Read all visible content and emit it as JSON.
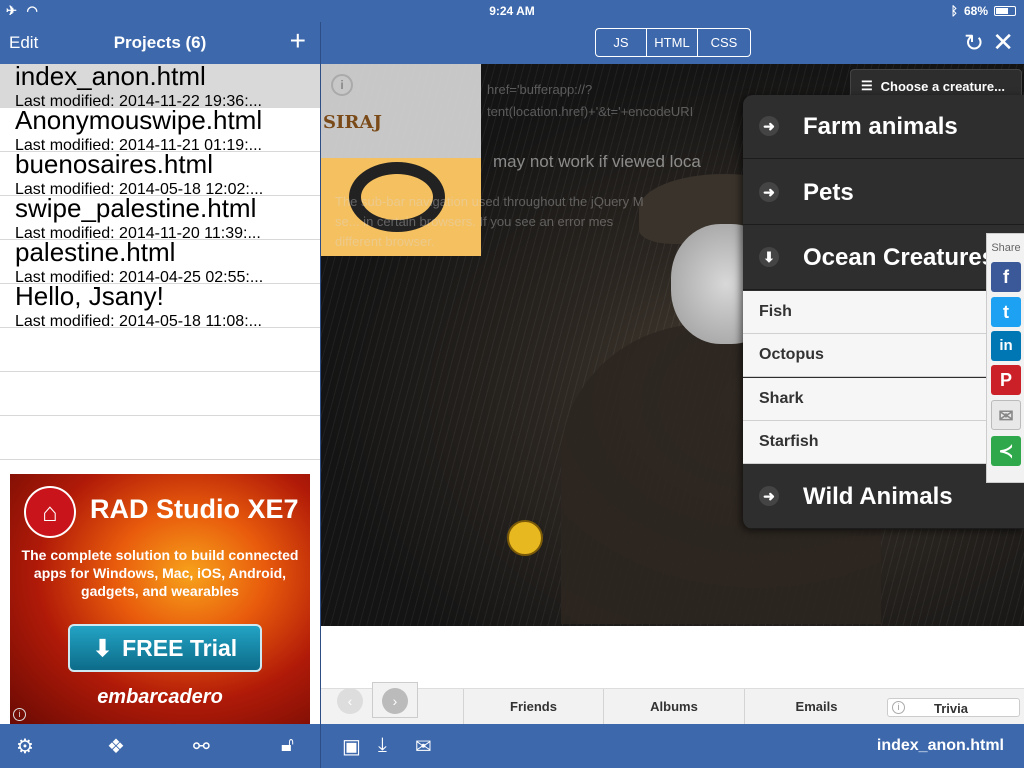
{
  "status": {
    "time": "9:24 AM",
    "battery": "68%",
    "battery_level": 0.68
  },
  "left": {
    "edit_label": "Edit",
    "title": "Projects (6)",
    "add_label": "+",
    "projects": [
      {
        "name": "index_anon.html",
        "modified": "Last modified: 2014-11-22 19:36:..."
      },
      {
        "name": "Anonymouswipe.html",
        "modified": "Last modified: 2014-11-21 01:19:..."
      },
      {
        "name": "buenosaires.html",
        "modified": "Last modified: 2014-05-18 12:02:..."
      },
      {
        "name": "swipe_palestine.html",
        "modified": "Last modified: 2014-11-20 11:39:..."
      },
      {
        "name": "palestine.html",
        "modified": "Last modified: 2014-04-25 02:55:..."
      },
      {
        "name": "Hello, Jsany!",
        "modified": "Last modified: 2014-05-18 11:08:..."
      }
    ]
  },
  "ad": {
    "title": "RAD Studio XE7",
    "subtitle": "The complete solution to build connected apps for Windows, Mac, iOS, Android, gadgets, and wearables",
    "button": "FREE Trial",
    "brand": "embarcadero"
  },
  "editor": {
    "segments": [
      "JS",
      "HTML",
      "CSS"
    ],
    "choose_label": "Choose a creature...",
    "ghost_text": [
      "href='bufferapp://?",
      "tent(location.href)+'&t='+encodeURI",
      "may not work if viewed loca",
      "The sub-bar navigation used throughout the jQuery M",
      "se... in certain browsers. If you see an error mes",
      "different browser."
    ],
    "logo_text": "SIRAJ",
    "menu": {
      "categories": [
        "Farm animals",
        "Pets",
        "Ocean Creatures",
        "Wild Animals"
      ],
      "ocean_items": [
        "Fish",
        "Octopus",
        "Shark",
        "Starfish"
      ]
    },
    "share_label": "Share",
    "tabs": [
      "Friends",
      "Albums",
      "Emails",
      "Trivia"
    ],
    "filename": "index_anon.html"
  }
}
